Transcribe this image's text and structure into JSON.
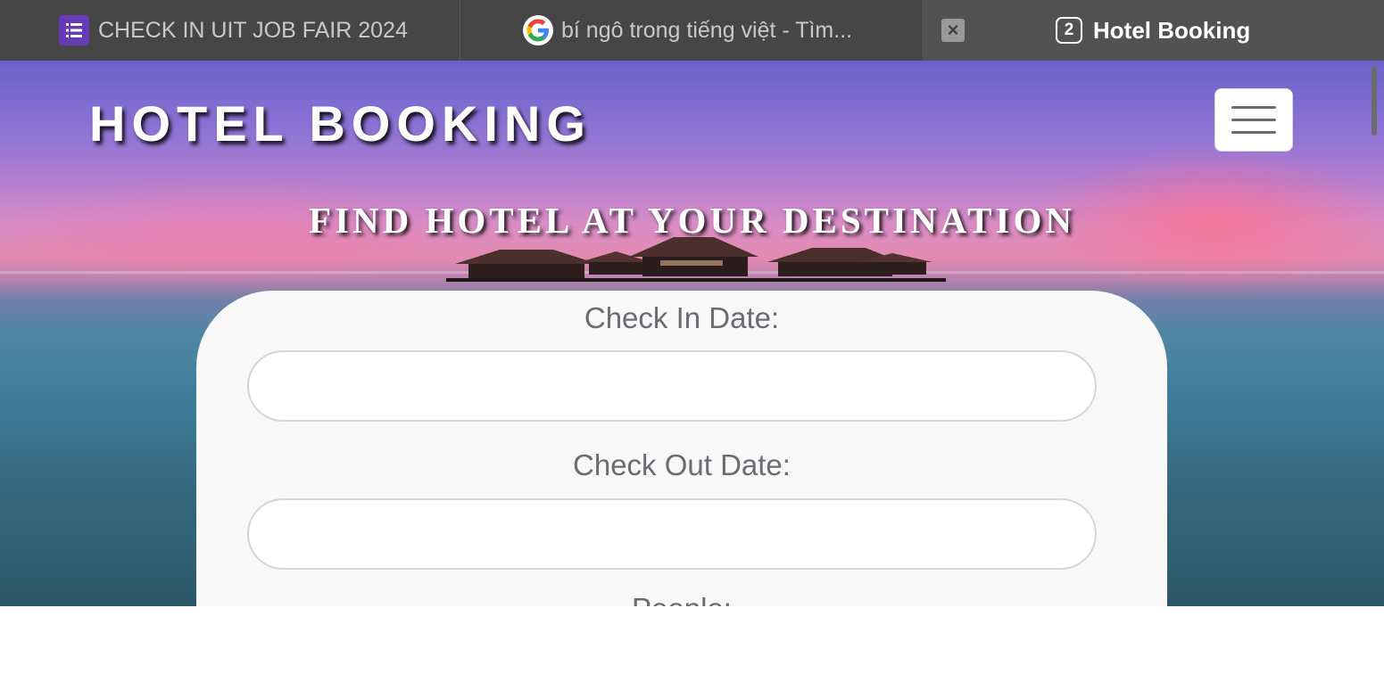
{
  "tabs": [
    {
      "label": "CHECK IN UIT JOB FAIR 2024",
      "icon": "google-forms-icon"
    },
    {
      "label": "bí ngô trong tiếng việt - Tìm...",
      "icon": "google-icon"
    },
    {
      "label": "Hotel Booking",
      "icon": "close-tab-icon",
      "count": "2"
    }
  ],
  "brand": "HOTEL BOOKING",
  "headline": "FIND HOTEL AT YOUR DESTINATION",
  "form": {
    "check_in_label": "Check In Date:",
    "check_in_value": "",
    "check_out_label": "Check Out Date:",
    "check_out_value": "",
    "people_label": "People:"
  },
  "colors": {
    "forms_accent": "#673ab7",
    "card_background": "#f8f8f9",
    "label_text": "#6b6b72"
  }
}
